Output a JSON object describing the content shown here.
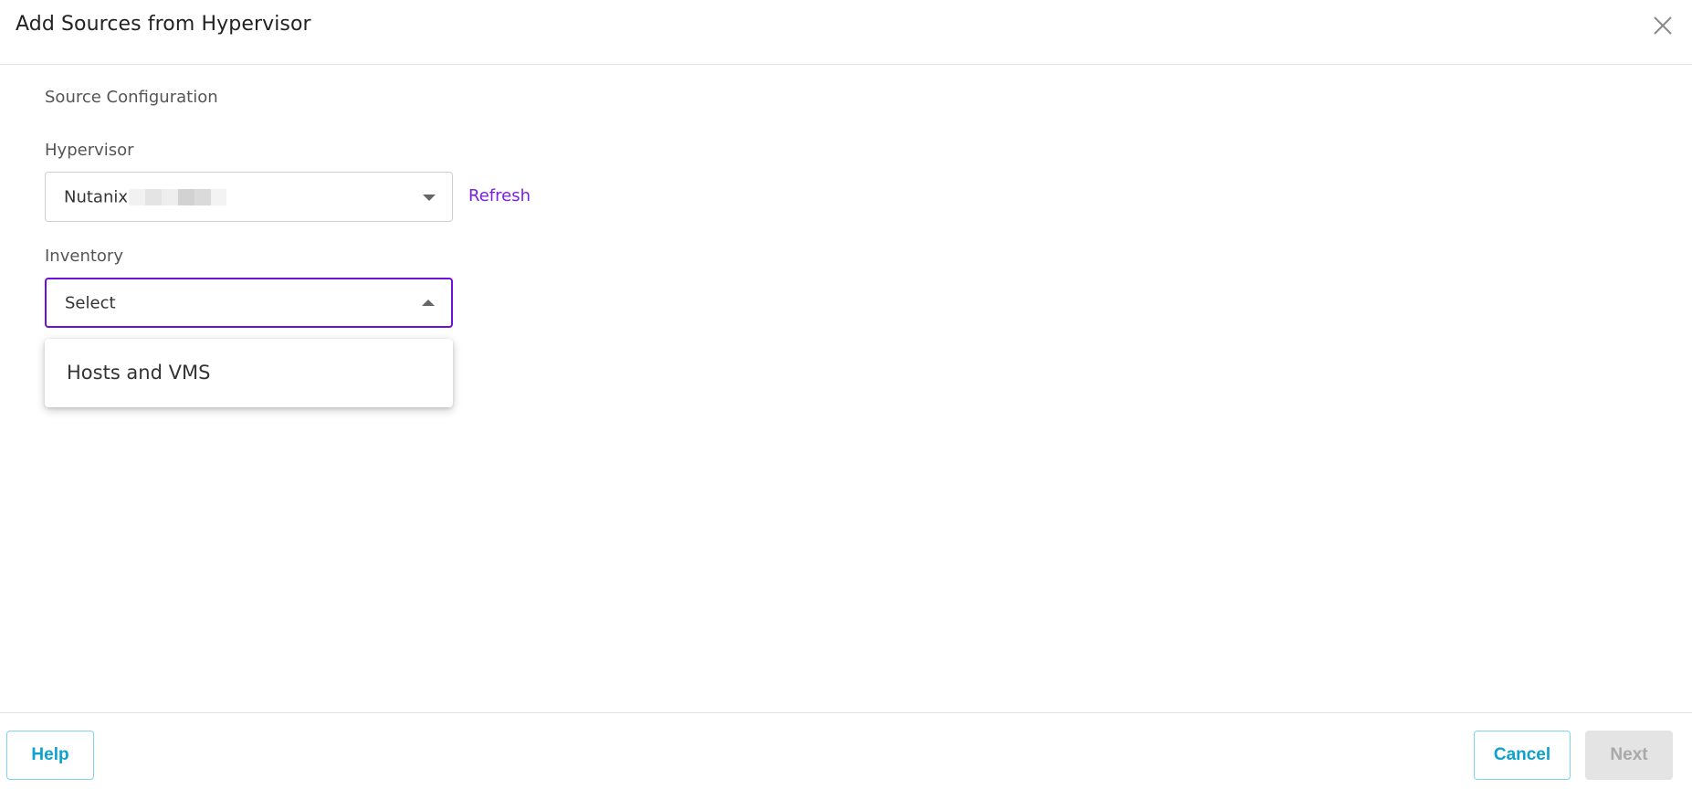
{
  "dialog": {
    "title": "Add Sources from Hypervisor"
  },
  "source_configuration": {
    "section_label": "Source Configuration",
    "hypervisor": {
      "label": "Hypervisor",
      "value_prefix": "Nutanix:",
      "refresh_label": "Refresh"
    },
    "inventory": {
      "label": "Inventory",
      "placeholder": "Select",
      "options": [
        "Hosts and VMS"
      ]
    }
  },
  "footer": {
    "help_label": "Help",
    "cancel_label": "Cancel",
    "next_label": "Next"
  },
  "colors": {
    "accent_purple": "#6e10d8",
    "link_purple": "#7a1ee0",
    "button_blue": "#0ea1cc",
    "disabled_gray": "#e4e4e4"
  },
  "icons": {
    "close": "close-icon",
    "dropdown_closed": "chevron-down-icon",
    "dropdown_open": "chevron-up-icon"
  }
}
